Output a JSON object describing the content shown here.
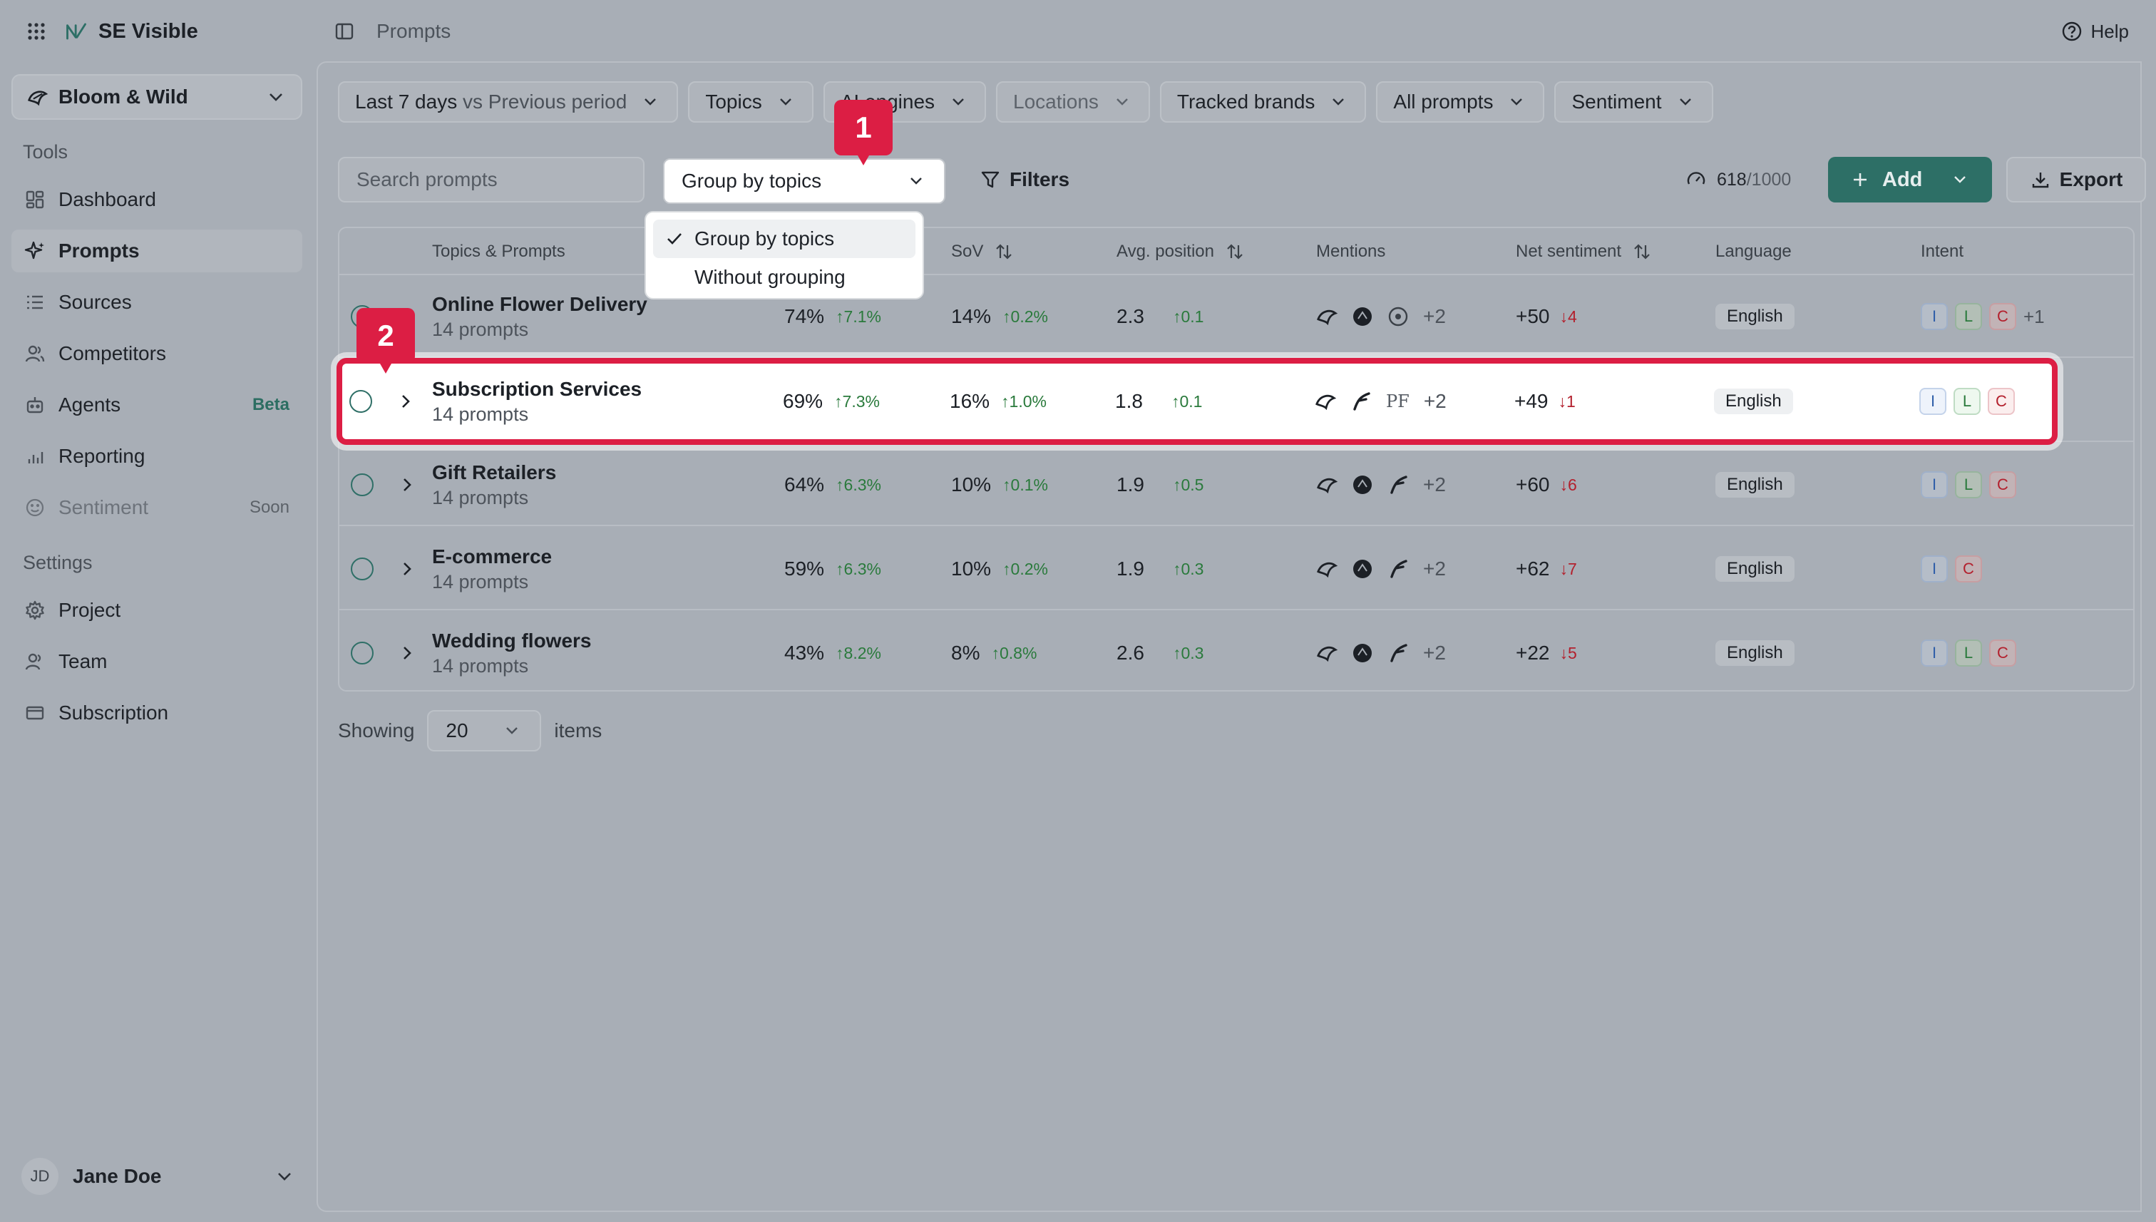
{
  "app": {
    "title": "SE Visible"
  },
  "brand_selector": {
    "label": "Bloom & Wild"
  },
  "sidebar": {
    "tools_title": "Tools",
    "tools": [
      {
        "label": "Dashboard"
      },
      {
        "label": "Prompts"
      },
      {
        "label": "Sources"
      },
      {
        "label": "Competitors"
      },
      {
        "label": "Agents",
        "badge": "Beta"
      },
      {
        "label": "Reporting"
      },
      {
        "label": "Sentiment",
        "badge": "Soon"
      }
    ],
    "settings_title": "Settings",
    "settings": [
      {
        "label": "Project"
      },
      {
        "label": "Team"
      },
      {
        "label": "Subscription"
      }
    ]
  },
  "user": {
    "initials": "JD",
    "name": "Jane Doe"
  },
  "header": {
    "breadcrumb": "Prompts",
    "help_label": "Help"
  },
  "filters": {
    "period": "Last 7 days",
    "period_compare": "vs Previous period",
    "topics": "Topics",
    "engines": "AI engines",
    "locations": "Locations",
    "brands": "Tracked brands",
    "prompts": "All prompts",
    "sentiment": "Sentiment"
  },
  "toolbar": {
    "search_placeholder": "Search prompts",
    "group_value": "Group by topics",
    "filters_label": "Filters",
    "quota_used": "618",
    "quota_max": "/1000",
    "add_label": "Add",
    "export_label": "Export"
  },
  "dropdown": {
    "options": [
      {
        "label": "Group by topics",
        "selected": true
      },
      {
        "label": "Without grouping",
        "selected": false
      }
    ]
  },
  "table": {
    "columns": {
      "topics": "Topics & Prompts",
      "sov": "SoV",
      "position": "Avg. position",
      "mentions": "Mentions",
      "sentiment": "Net sentiment",
      "language": "Language",
      "intent": "Intent"
    },
    "rows": [
      {
        "name": "Online Flower Delivery",
        "count": "14 prompts",
        "visibility": "74%",
        "visibility_delta": "↑7.1%",
        "sov": "14%",
        "sov_delta": "↑0.2%",
        "position": "2.3",
        "position_delta": "↑0.1",
        "mentions_more": "+2",
        "sentiment": "+50",
        "sentiment_delta": "↓4",
        "language": "English",
        "intent_more": "+1"
      },
      {
        "name": "Subscription Services",
        "count": "14 prompts",
        "visibility": "69%",
        "visibility_delta": "↑7.3%",
        "sov": "16%",
        "sov_delta": "↑1.0%",
        "position": "1.8",
        "position_delta": "↑0.1",
        "mentions_more": "+2",
        "sentiment": "+49",
        "sentiment_delta": "↓1",
        "language": "English"
      },
      {
        "name": "Gift Retailers",
        "count": "14 prompts",
        "visibility": "64%",
        "visibility_delta": "↑6.3%",
        "sov": "10%",
        "sov_delta": "↑0.1%",
        "position": "1.9",
        "position_delta": "↑0.5",
        "mentions_more": "+2",
        "sentiment": "+60",
        "sentiment_delta": "↓6",
        "language": "English"
      },
      {
        "name": "E-commerce",
        "count": "14 prompts",
        "visibility": "59%",
        "visibility_delta": "↑6.3%",
        "sov": "10%",
        "sov_delta": "↑0.2%",
        "position": "1.9",
        "position_delta": "↑0.3",
        "mentions_more": "+2",
        "sentiment": "+62",
        "sentiment_delta": "↓7",
        "language": "English"
      },
      {
        "name": "Wedding flowers",
        "count": "14 prompts",
        "visibility": "43%",
        "visibility_delta": "↑8.2%",
        "sov": "8%",
        "sov_delta": "↑0.8%",
        "position": "2.6",
        "position_delta": "↑0.3",
        "mentions_more": "+2",
        "sentiment": "+22",
        "sentiment_delta": "↓5",
        "language": "English"
      }
    ],
    "intent_letters": {
      "i": "I",
      "l": "L",
      "c": "C"
    },
    "pf_mark": "PF"
  },
  "pagination": {
    "showing_label": "Showing",
    "page_size": "20",
    "items_label": "items"
  },
  "markers": {
    "one": "1",
    "two": "2"
  },
  "colors": {
    "accent": "#2d6f66",
    "highlight": "#dc1e44",
    "positive": "#2a7a3c",
    "negative": "#b3202d"
  }
}
